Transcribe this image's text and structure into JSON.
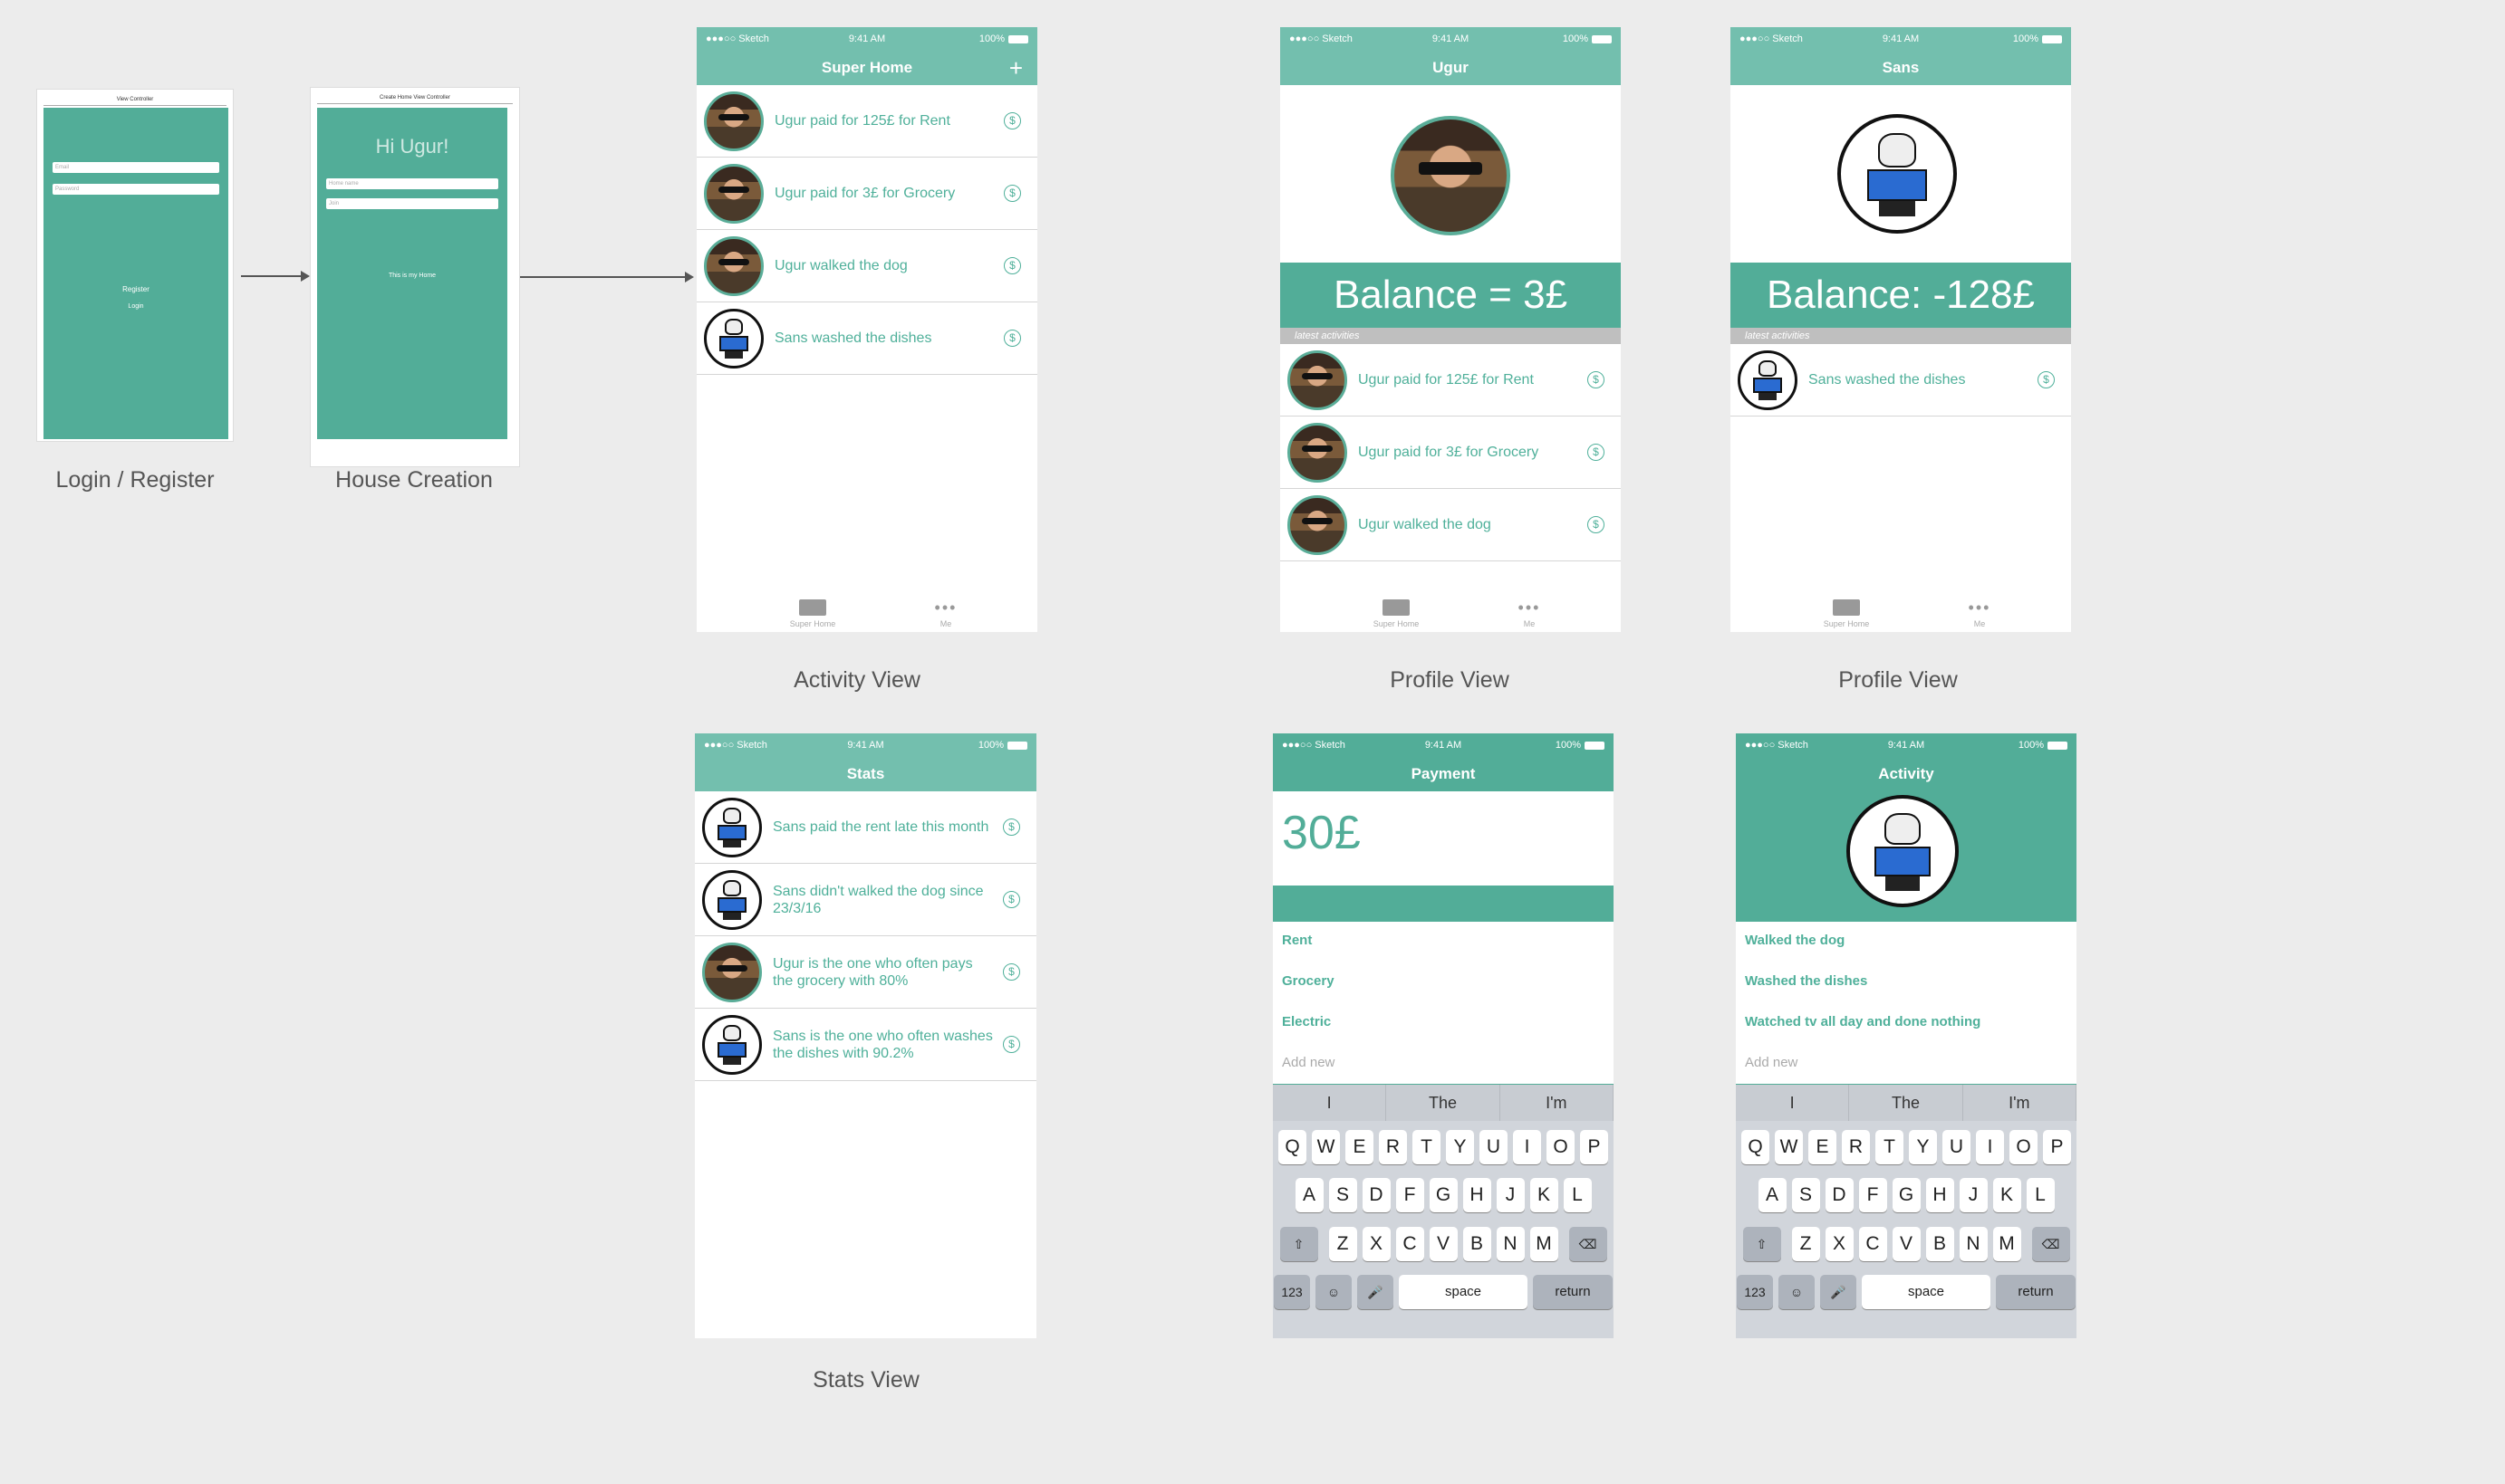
{
  "status": {
    "carrier": "Sketch",
    "time": "9:41 AM",
    "battery": "100%"
  },
  "login": {
    "title": "View Controller",
    "field1": "Email",
    "field2": "Password",
    "register": "Register",
    "login": "Login",
    "caption": "Login / Register"
  },
  "house": {
    "title": "Create Home View Controller",
    "greeting": "Hi Ugur!",
    "field1": "Home name",
    "field2": "Join",
    "subtitle": "This is my Home",
    "caption": "House Creation"
  },
  "activity": {
    "title": "Super Home",
    "plus": "+",
    "caption": "Activity View",
    "rows": [
      {
        "avatar": "ugur",
        "text": "Ugur paid for 125£ for Rent"
      },
      {
        "avatar": "ugur",
        "text": "Ugur paid for 3£ for Grocery"
      },
      {
        "avatar": "ugur",
        "text": "Ugur walked the dog"
      },
      {
        "avatar": "sans",
        "text": "Sans washed the dishes"
      }
    ]
  },
  "tabs": {
    "home": "Super Home",
    "me": "Me"
  },
  "dollar": "$",
  "profile1": {
    "title": "Ugur",
    "balance": "Balance = 3£",
    "latest": "latest activities",
    "caption": "Profile View",
    "rows": [
      {
        "avatar": "ugur",
        "text": "Ugur paid for 125£ for Rent"
      },
      {
        "avatar": "ugur",
        "text": "Ugur paid for 3£ for Grocery"
      },
      {
        "avatar": "ugur",
        "text": "Ugur walked the dog"
      }
    ]
  },
  "profile2": {
    "title": "Sans",
    "balance": "Balance: -128£",
    "latest": "latest activities",
    "caption": "Profile View",
    "rows": [
      {
        "avatar": "sans",
        "text": "Sans washed the dishes"
      }
    ]
  },
  "stats": {
    "title": "Stats",
    "caption": "Stats View",
    "rows": [
      {
        "avatar": "sans",
        "text": "Sans paid the rent late this month"
      },
      {
        "avatar": "sans",
        "text": "Sans didn't walked the dog since 23/3/16"
      },
      {
        "avatar": "ugur",
        "text": "Ugur is the one who often pays the grocery with 80%"
      },
      {
        "avatar": "sans",
        "text": "Sans is the one who often washes the dishes with 90.2%"
      }
    ]
  },
  "payment": {
    "title": "Payment",
    "amount": "30£",
    "items": [
      "Rent",
      "Grocery",
      "Electric"
    ],
    "add": "Add new"
  },
  "activity2": {
    "title": "Activity",
    "items": [
      "Walked the dog",
      "Washed the dishes",
      "Watched tv all day and done nothing"
    ],
    "add": "Add new"
  },
  "keyboard": {
    "suggestions": [
      "I",
      "The",
      "I'm"
    ],
    "row1": [
      "Q",
      "W",
      "E",
      "R",
      "T",
      "Y",
      "U",
      "I",
      "O",
      "P"
    ],
    "row2": [
      "A",
      "S",
      "D",
      "F",
      "G",
      "H",
      "J",
      "K",
      "L"
    ],
    "row3": [
      "Z",
      "X",
      "C",
      "V",
      "B",
      "N",
      "M"
    ],
    "num": "123",
    "space": "space",
    "return": "return"
  },
  "colors": {
    "accent": "#52ad98",
    "navbar": "#73bfae",
    "text": "#4fb09a"
  }
}
